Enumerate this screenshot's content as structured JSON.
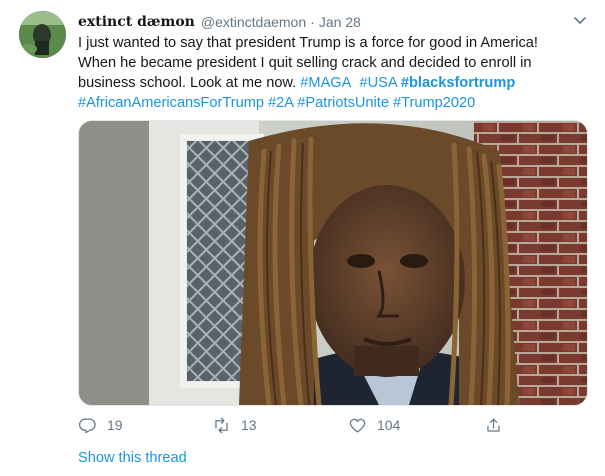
{
  "tweet": {
    "display_name": "extinct dæmon",
    "handle": "@extinctdaemon",
    "separator": "·",
    "date": "Jan 28",
    "text_lines": [
      "I just wanted to say that president Trump is a force for good in America!",
      "When he became president I quit selling crack and decided to enroll in",
      "business school. Look at me now."
    ],
    "hashtags_line3": [
      "#MAGA",
      "#USA",
      "#blacksfortrump"
    ],
    "hashtags_line4": [
      "#AfricanAmericansForTrump",
      "#2A",
      "#PatriotsUnite",
      "#Trump2020"
    ],
    "media_icon": "photo-of-man-with-long-locs"
  },
  "actions": {
    "reply": {
      "icon": "reply-icon",
      "count": "19"
    },
    "retweet": {
      "icon": "retweet-icon",
      "count": "13"
    },
    "like": {
      "icon": "heart-icon",
      "count": "104"
    },
    "share": {
      "icon": "share-icon"
    }
  },
  "show_thread": "Show this thread",
  "colors": {
    "link": "#1b95e0",
    "secondary": "#657786",
    "text": "#14171a"
  }
}
